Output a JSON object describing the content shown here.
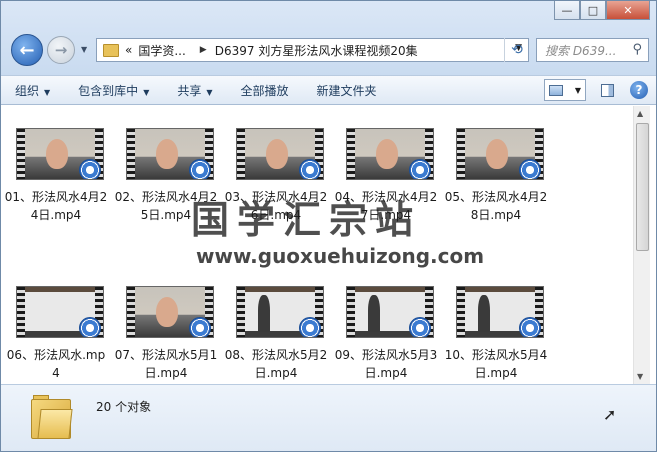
{
  "window": {
    "minimize_glyph": "—",
    "maximize_glyph": "□",
    "close_glyph": "✕"
  },
  "address": {
    "overflow": "«",
    "crumbs": [
      "国学资...",
      "D6397  刘方星形法风水课程视频20集"
    ],
    "separator": "▶"
  },
  "search": {
    "placeholder": "搜索 D639..."
  },
  "toolbar": {
    "organize": "组织",
    "include_library": "包含到库中",
    "share": "共享",
    "play_all": "全部播放",
    "new_folder": "新建文件夹"
  },
  "files": [
    {
      "name": "01、形法风水4月24日.mp4",
      "style": "person"
    },
    {
      "name": "02、形法风水4月25日.mp4",
      "style": "person"
    },
    {
      "name": "03、形法风水4月26日.mp4",
      "style": "person"
    },
    {
      "name": "04、形法风水4月27日.mp4",
      "style": "person"
    },
    {
      "name": "05、形法风水4月28日.mp4",
      "style": "person"
    },
    {
      "name": "06、形法风水.mp4",
      "style": "whiteboard"
    },
    {
      "name": "07、形法风水5月1日.mp4",
      "style": "person"
    },
    {
      "name": "08、形法风水5月2日.mp4",
      "style": "whiteboard-man"
    },
    {
      "name": "09、形法风水5月3日.mp4",
      "style": "whiteboard-man"
    },
    {
      "name": "10、形法风水5月4日.mp4",
      "style": "whiteboard-man"
    }
  ],
  "status": {
    "count_text": "20 个对象"
  },
  "watermark": {
    "title": "国学汇宗站",
    "url": "www.guoxuehuizong.com"
  },
  "icons": {
    "back": "back-arrow-icon",
    "forward": "forward-arrow-icon",
    "refresh": "refresh-icon",
    "search": "search-icon",
    "help": "help-icon"
  }
}
